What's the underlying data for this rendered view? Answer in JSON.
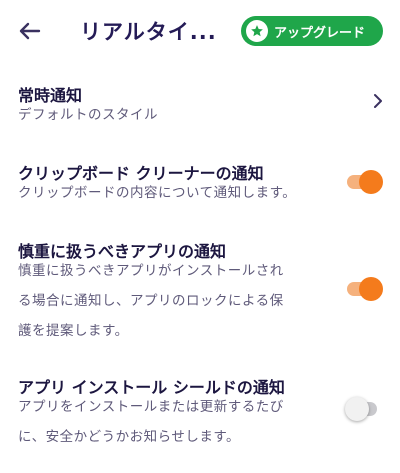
{
  "header": {
    "title": "リアルタイ...",
    "upgrade_label": "アップグレード",
    "back_icon": "arrow-left-icon",
    "upgrade_icon": "star-badge-icon"
  },
  "colors": {
    "title": "#241b56",
    "upgrade_bg": "#1fa64a",
    "toggle_on": "#f47b1c",
    "toggle_off": "#c9c9cd"
  },
  "settings": [
    {
      "title": "常時通知",
      "desc_lines": [
        "デフォルトのスタイル"
      ],
      "control": "chevron"
    },
    {
      "title": "クリップボード クリーナーの通知",
      "desc_lines": [
        "クリップボードの内容について通知します。"
      ],
      "control": "toggle",
      "enabled": true
    },
    {
      "title": "慎重に扱うべきアプリの通知",
      "desc_lines": [
        "慎重に扱うべきアプリがインストールされ",
        "る場合に通知し、アプリのロックによる保",
        "護を提案します。"
      ],
      "control": "toggle",
      "enabled": true
    },
    {
      "title": "アプリ インストール シールドの通知",
      "desc_lines": [
        "アプリをインストールまたは更新するたび",
        "に、安全かどうかお知らせします。"
      ],
      "control": "toggle",
      "enabled": false
    }
  ]
}
